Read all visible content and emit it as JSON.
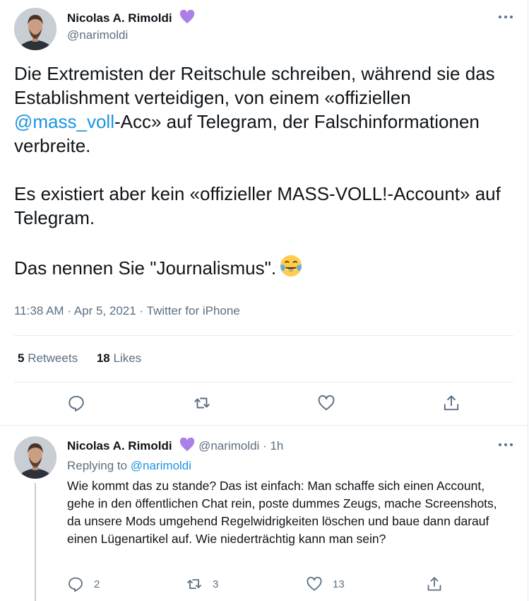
{
  "main_tweet": {
    "author": {
      "name": "Nicolas A. Rimoldi",
      "handle": "@narimoldi",
      "badge": "purple-heart"
    },
    "text": {
      "p1_before": "Die Extremisten der Reitschule schreiben, während sie das Establishment verteidigen, von einem «offiziellen ",
      "p1_mention": "@mass_voll",
      "p1_after": "-Acc» auf Telegram, der Falschinformationen verbreite.",
      "p2": "Es existiert aber kein «offizieller MASS-VOLL!-Account» auf Telegram.",
      "p3": "Das nennen Sie \"Journalismus\".",
      "p3_emoji": "face-with-tears-of-joy"
    },
    "time": "11:38 AM",
    "date": "Apr 5, 2021",
    "source": "Twitter for iPhone",
    "separator": "·",
    "retweets_count": "5",
    "retweets_label": "Retweets",
    "likes_count": "18",
    "likes_label": "Likes",
    "actions": [
      "reply-icon",
      "retweet-icon",
      "like-icon",
      "share-icon"
    ]
  },
  "reply_tweet": {
    "author": {
      "name": "Nicolas A. Rimoldi",
      "handle": "@narimoldi",
      "badge": "purple-heart"
    },
    "separator": "·",
    "age": "1h",
    "replying_prefix": "Replying to",
    "replying_to": "@narimoldi",
    "text": "Wie kommt das zu stande? Das ist einfach: Man schaffe sich einen Account, gehe in den öffentlichen Chat rein, poste dummes Zeugs, mache Screenshots, da unsere Mods umgehend Regelwidrigkeiten löschen und baue dann darauf einen Lügenartikel auf. Wie niederträchtig kann man sein?",
    "reply_count": "2",
    "retweet_count": "3",
    "like_count": "13"
  },
  "colors": {
    "link": "#1b95e0",
    "secondary": "#5b7083",
    "heart": "#ab7fe6",
    "divider": "#e6ecf0"
  }
}
